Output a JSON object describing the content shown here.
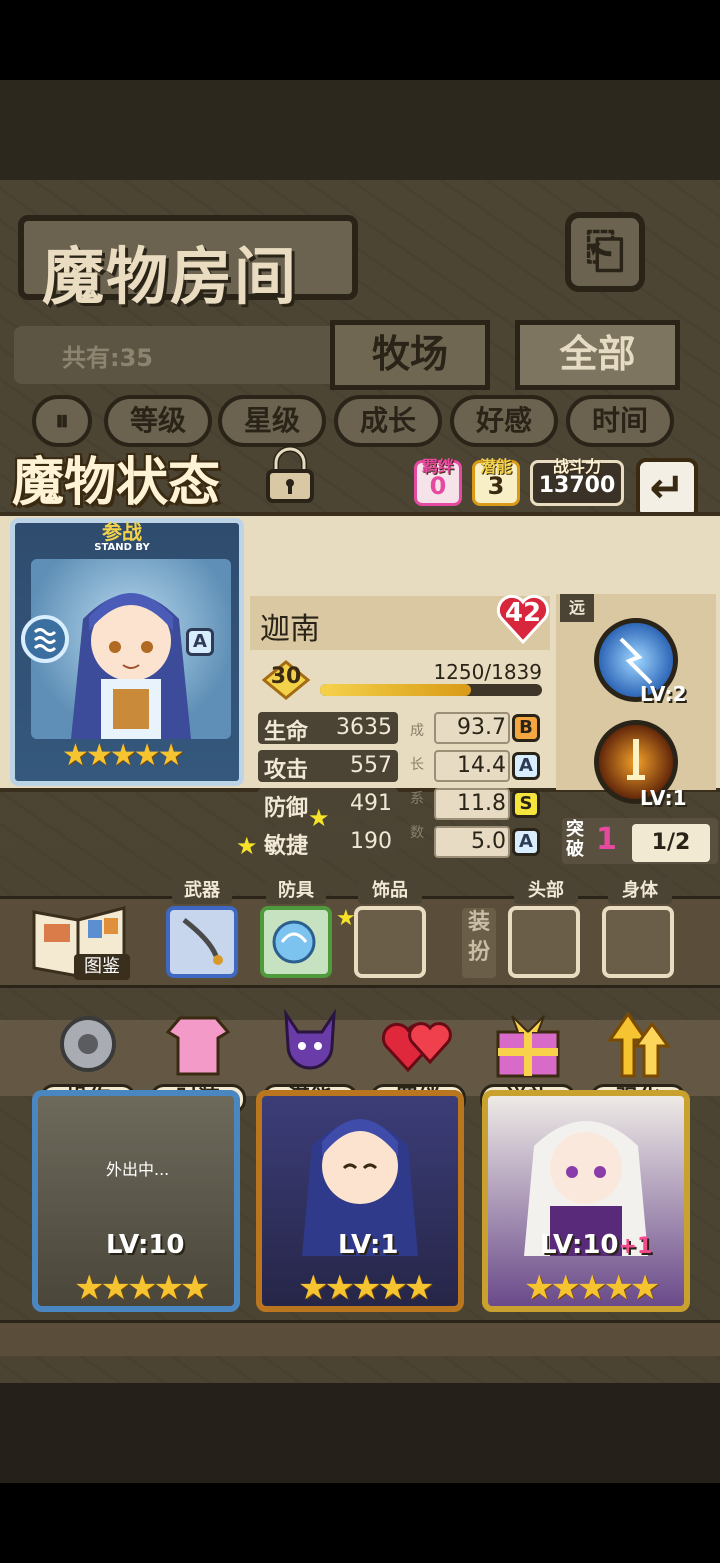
{
  "room": {
    "title": "魔物房间",
    "count_label": "共有:35",
    "tabs": [
      "牧场",
      "全部"
    ],
    "sort_buttons": [
      "等级",
      "星级",
      "成长",
      "好感",
      "时间"
    ]
  },
  "status_panel": {
    "title": "魔物状态",
    "bond_label": "羁绊",
    "bond_value": "0",
    "potential_label": "潜能",
    "potential_value": "3",
    "power_label": "战斗力",
    "power_value": "13700"
  },
  "card": {
    "standby_cn": "参战",
    "standby_en": "STAND BY",
    "rank": "A",
    "stars": "★★★★★",
    "star_count": 5
  },
  "monster": {
    "name": "迦南",
    "affection": "42",
    "level": "30",
    "exp_text": "1250/1839",
    "exp_fraction": 0.68,
    "growth_vertical": [
      "成",
      "长",
      "系",
      "数"
    ],
    "stats": [
      {
        "label": "生命",
        "value": "3635",
        "growth": "93.7",
        "grade": "B"
      },
      {
        "label": "攻击",
        "value": "557",
        "growth": "14.4",
        "grade": "A"
      },
      {
        "label": "防御",
        "value": "491",
        "growth": "11.8",
        "grade": "S"
      },
      {
        "label": "敏捷",
        "value": "190",
        "growth": "5.0",
        "grade": "A"
      }
    ]
  },
  "skills": {
    "range_tag": "远",
    "skill1_lv": "LV:2",
    "skill2_lv": "LV:1",
    "breakthrough_label": "突破",
    "breakthrough_value": "1",
    "breakthrough_frac": "1/2"
  },
  "equipment": {
    "book_label": "图鉴",
    "weapon": "武器",
    "armor": "防具",
    "accessory": "饰品",
    "dress_tag": "装扮",
    "head": "头部",
    "body": "身体"
  },
  "actions": [
    "操作",
    "时装",
    "潜能",
    "羁绊",
    "送礼",
    "强化"
  ],
  "monsters_below": [
    {
      "lv": "LV:10",
      "status": "外出中...",
      "stars": "★★★★★"
    },
    {
      "lv": "LV:1",
      "status": "",
      "stars": "★★★★★"
    },
    {
      "lv": "LV:10",
      "plus": "+1",
      "status": "",
      "stars": "★★★★★"
    }
  ],
  "colors": {
    "gold": "#f7c431",
    "pink": "#e64aa0",
    "grade_A": "#d8eefe",
    "grade_B": "#f4a640",
    "grade_S": "#f6e53c"
  }
}
